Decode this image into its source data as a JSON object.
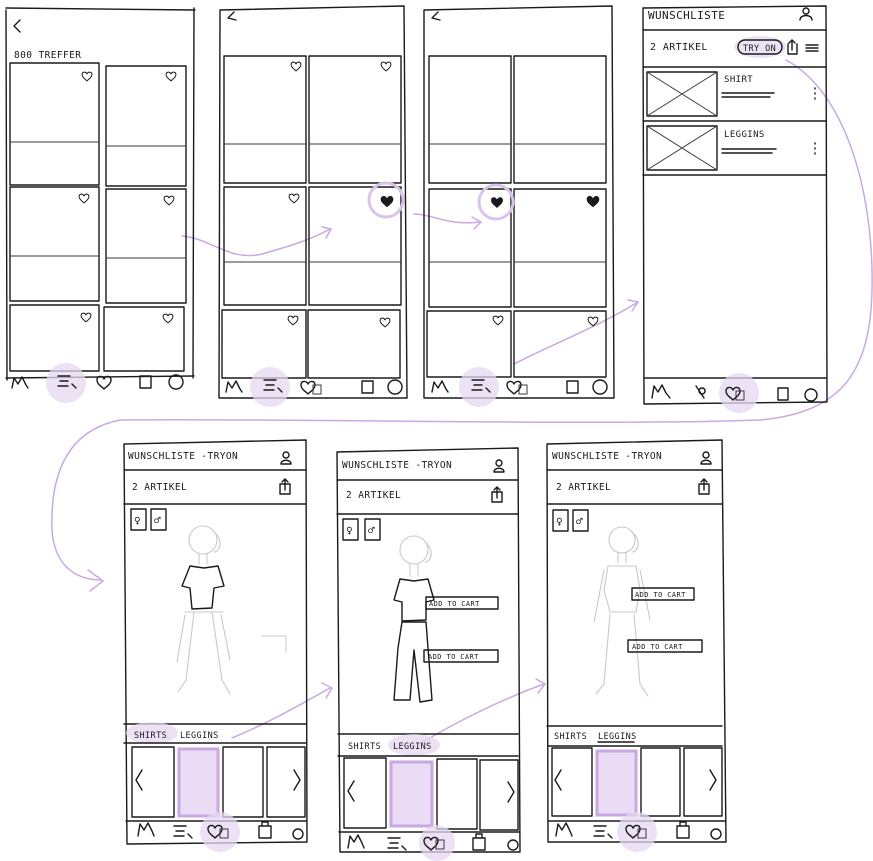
{
  "colors": {
    "ink": "#1a1a1a",
    "highlight": "#e6d7f2",
    "flow": "#c9a9e4"
  },
  "screen1": {
    "back_icon": "chevron-left-icon",
    "results_label": "800 TREFFER"
  },
  "wishlist": {
    "title": "WUNSCHLISTE",
    "count": "2 ARTIKEL",
    "tryon_button": "TRY ON",
    "items": [
      {
        "name": "SHIRT"
      },
      {
        "name": "LEGGINS"
      }
    ]
  },
  "tryon_screens": [
    {
      "title": "WUNSCHLISTE -TRYON",
      "count": "2 ARTIKEL",
      "tab_shirts": "SHIRTS",
      "tab_leggins": "LEGGINS",
      "add_to_cart": []
    },
    {
      "title": "WUNSCHLISTE -TRYON",
      "count": "2 ARTIKEL",
      "tab_shirts": "SHIRTS",
      "tab_leggins": "LEGGINS",
      "add_to_cart": [
        "ADD TO CART",
        "ADD TO CART"
      ]
    },
    {
      "title": "WUNSCHLISTE -TRYON",
      "count": "2 ARTIKEL",
      "tab_shirts": "SHIRTS",
      "tab_leggins": "LEGGINS",
      "add_to_cart": [
        "ADD TO CART",
        "ADD TO CART"
      ]
    }
  ],
  "nav_icons": [
    "home-icon",
    "search-icon",
    "wishlist-icon",
    "bag-icon",
    "profile-icon"
  ]
}
